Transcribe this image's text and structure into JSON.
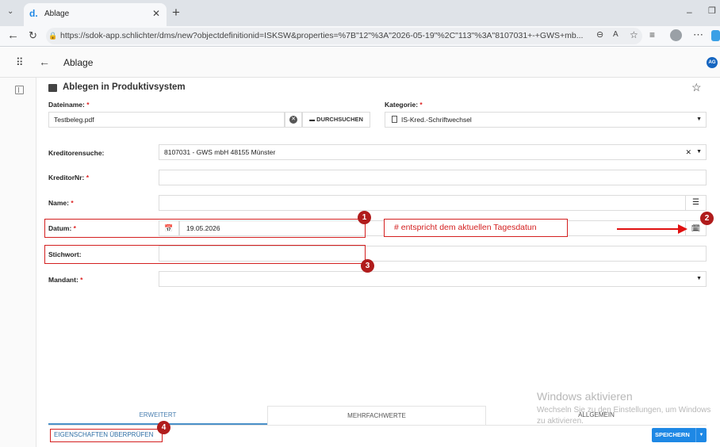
{
  "browser": {
    "tab_title": "Ablage",
    "url": "https://sdok-app.schlichter/dms/new?objectdefinitionid=ISKSW&properties=%7B\"12\"%3A\"2026-05-19\"%2C\"113\"%3A\"8107031+-+GWS+mb..."
  },
  "appbar": {
    "title": "Ablage",
    "avatar": "AG"
  },
  "card": {
    "title": "Ablegen in Produktivsystem"
  },
  "form": {
    "dateiname_label": "Dateiname:",
    "dateiname_value": "Testbeleg.pdf",
    "browse_label": "DURCHSUCHEN",
    "kategorie_label": "Kategorie:",
    "kategorie_value": "IS-Kred.-Schriftwechsel",
    "kreditorensuche_label": "Kreditorensuche:",
    "kreditorensuche_value": "8107031 - GWS mbH  48155 Münster",
    "kreditornr_label": "KreditorNr:",
    "name_label": "Name:",
    "datum_label": "Datum:",
    "datum_value": "19.05.2026",
    "stichwort_label": "Stichwort:",
    "mandant_label": "Mandant:",
    "required_mark": "*"
  },
  "annotation": {
    "note": "# entspricht dem aktuellen Tagesdatun",
    "badges": [
      "1",
      "2",
      "3",
      "4"
    ]
  },
  "bottom_tabs": [
    "ERWEITERT",
    "MEHRFACHWERTE",
    "ALLGEMEIN"
  ],
  "buttons": {
    "check_properties": "EIGENSCHAFTEN ÜBERPRÜFEN",
    "save": "SPEICHERN"
  },
  "watermark": {
    "title": "Windows aktivieren",
    "line1": "Wechseln Sie zu den Einstellungen, um Windows",
    "line2": "zu aktivieren."
  },
  "colors": {
    "annotation_red": "#d42020",
    "badge_red": "#b01c1c",
    "accent_blue": "#1e88e5"
  }
}
